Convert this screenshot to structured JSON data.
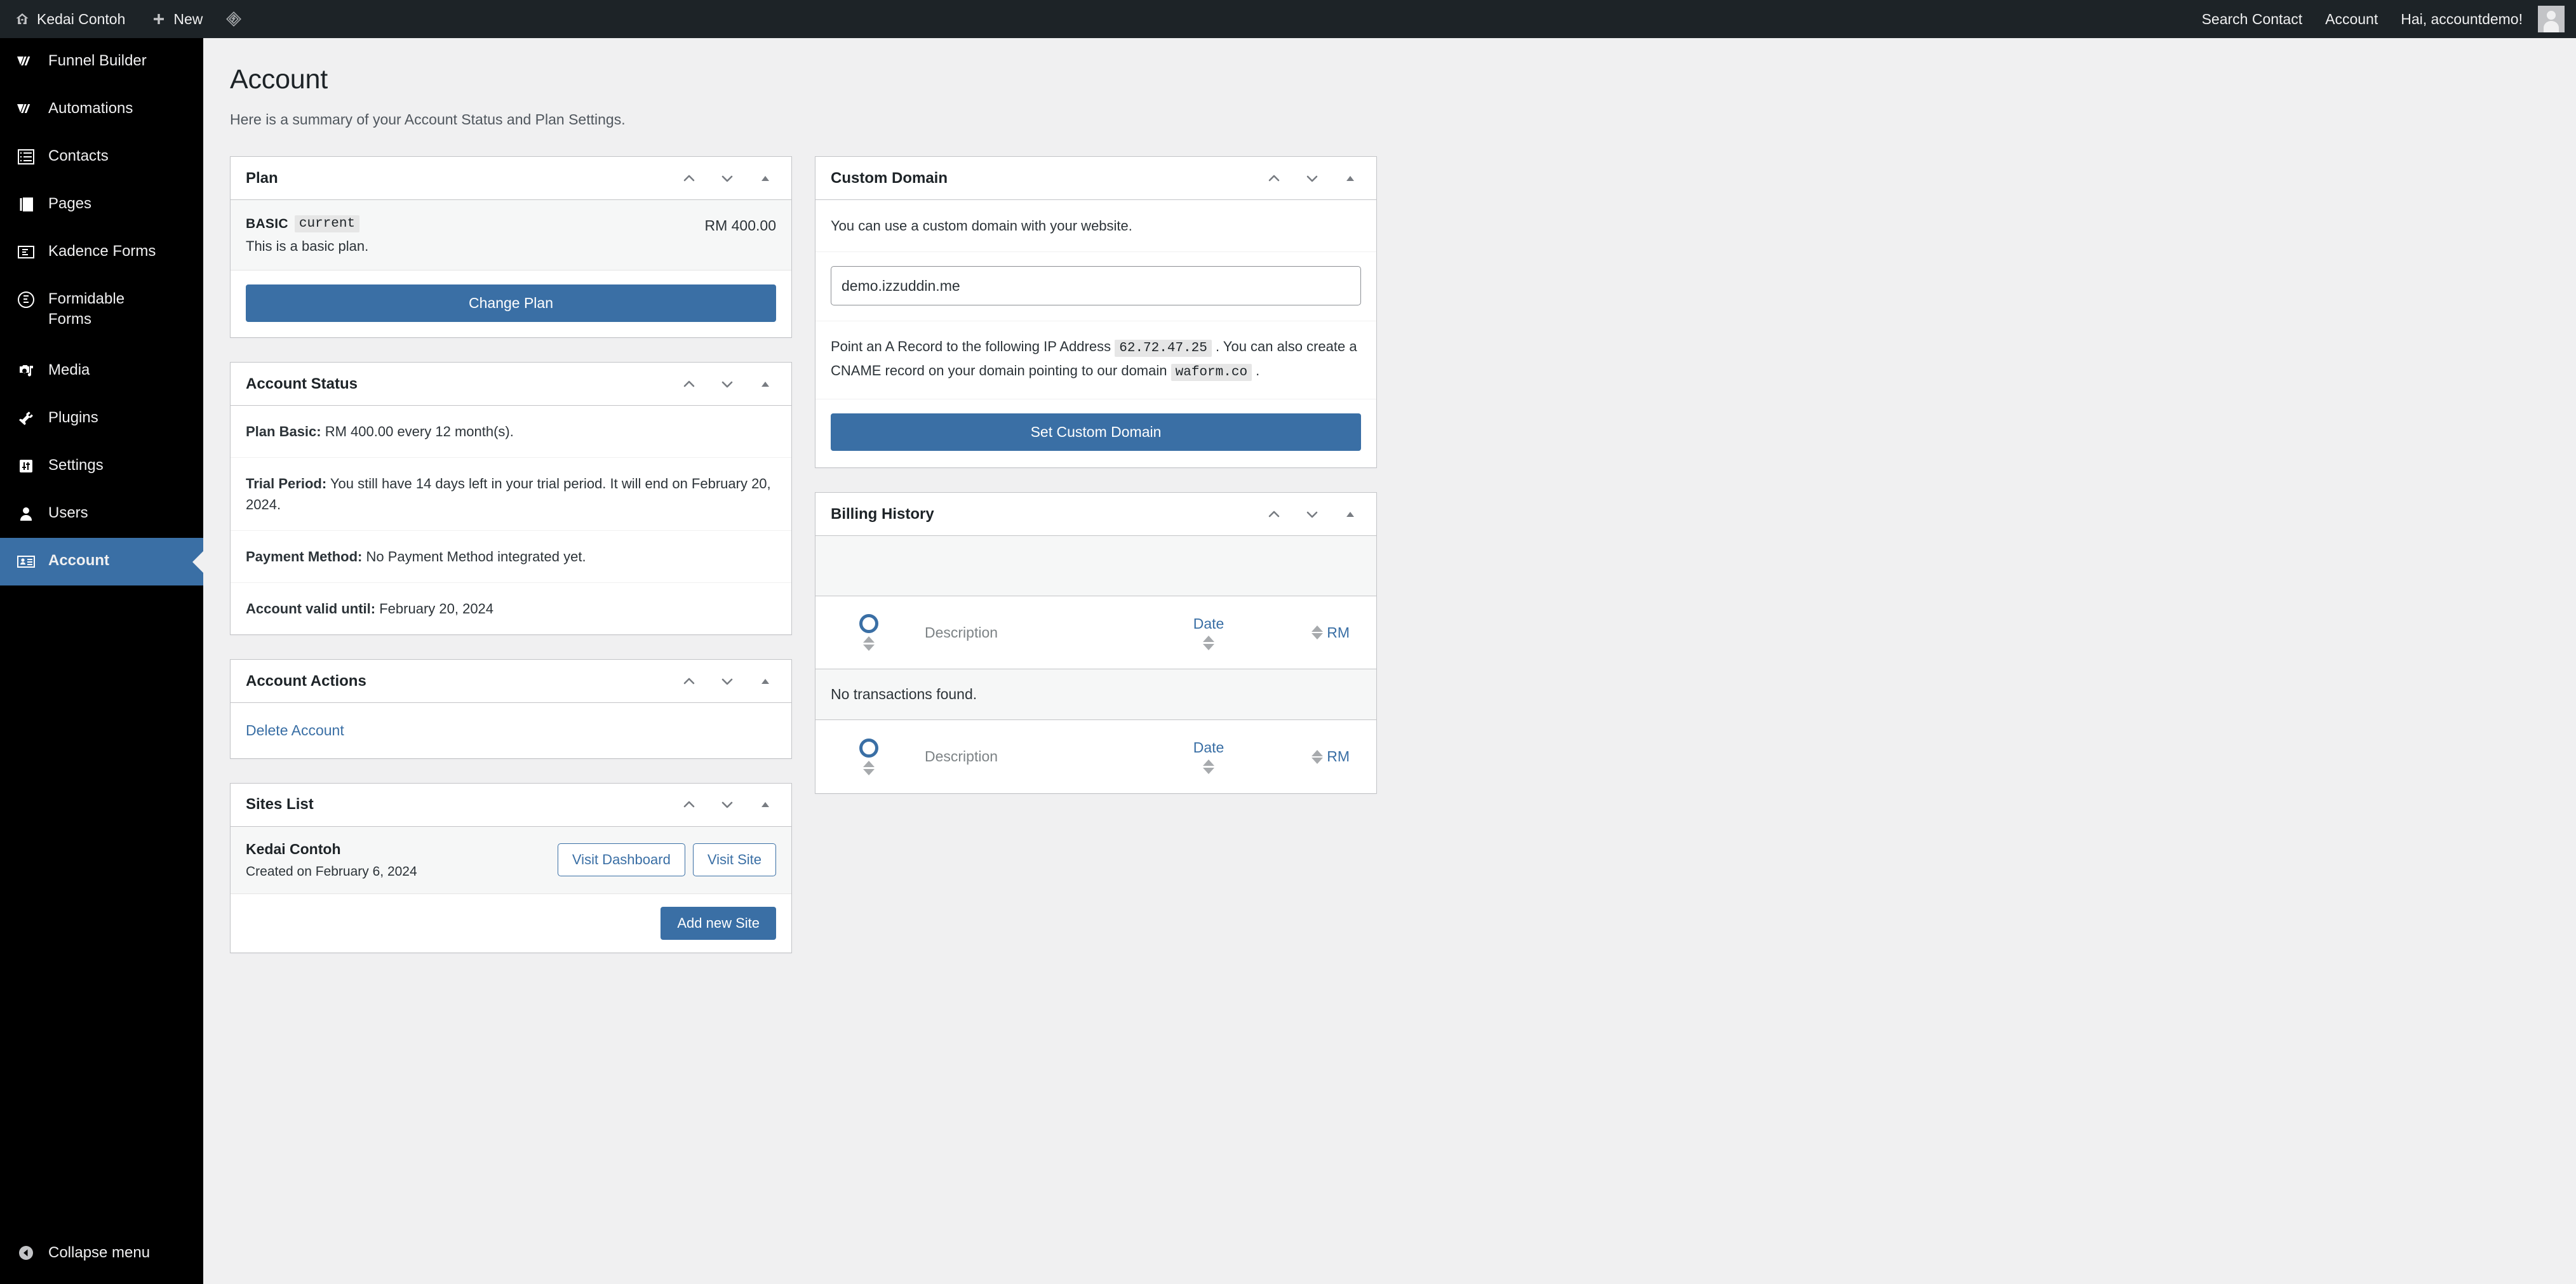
{
  "adminbar": {
    "site_name": "Kedai Contoh",
    "new_label": "New",
    "logo_icon": "diamond-logo-icon",
    "home_icon": "wordpress-home-icon",
    "plus_icon": "plus-icon",
    "right_items": [
      {
        "label": "Search Contact",
        "name": "adminbar-search-contact"
      },
      {
        "label": "Account",
        "name": "adminbar-account"
      },
      {
        "label": "Hai, accountdemo!",
        "name": "adminbar-howdy"
      }
    ],
    "avatar_icon": "user-avatar-icon"
  },
  "sidebar": {
    "items": [
      {
        "label": "Funnel Builder",
        "icon": "funnel-builder-logo-icon",
        "current": false
      },
      {
        "label": "Automations",
        "icon": "automations-logo-icon",
        "current": false
      },
      {
        "label": "Contacts",
        "icon": "list-view-icon",
        "current": false
      },
      {
        "label": "Pages",
        "icon": "pages-icon",
        "current": false
      },
      {
        "label": "Kadence Forms",
        "icon": "kadence-forms-icon",
        "current": false
      },
      {
        "label": "Formidable Forms",
        "icon": "formidable-forms-icon",
        "current": false
      },
      {
        "label": "Media",
        "icon": "media-icon",
        "current": false
      },
      {
        "label": "Plugins",
        "icon": "plugins-plug-icon",
        "current": false
      },
      {
        "label": "Settings",
        "icon": "settings-sliders-icon",
        "current": false
      },
      {
        "label": "Users",
        "icon": "users-person-icon",
        "current": false
      },
      {
        "label": "Account",
        "icon": "id-card-icon",
        "current": true
      }
    ],
    "collapse_label": "Collapse menu",
    "collapse_icon": "collapse-left-arrow-icon",
    "current_bg": "#3a6fa5"
  },
  "page": {
    "title": "Account",
    "subtitle": "Here is a summary of your Account Status and Plan Settings."
  },
  "panels": {
    "plan": {
      "title": "Plan",
      "plan_name": "BASIC",
      "plan_badge": "current",
      "plan_description": "This is a basic plan.",
      "price": "RM 400.00",
      "change_plan_label": "Change Plan"
    },
    "account_status": {
      "title": "Account Status",
      "rows": [
        {
          "label": "Plan Basic:",
          "value": " RM 400.00 every 12 month(s)."
        },
        {
          "label": "Trial Period:",
          "value": " You still have 14 days left in your trial period. It will end on February 20, 2024."
        },
        {
          "label": "Payment Method:",
          "value": " No Payment Method integrated yet."
        },
        {
          "label": "Account valid until:",
          "value": " February 20, 2024"
        }
      ]
    },
    "account_actions": {
      "title": "Account Actions",
      "delete_label": "Delete Account"
    },
    "sites_list": {
      "title": "Sites List",
      "site_name": "Kedai Contoh",
      "site_created": "Created on February 6, 2024",
      "visit_dashboard_label": "Visit Dashboard",
      "visit_site_label": "Visit Site",
      "add_new_site_label": "Add new Site"
    },
    "custom_domain": {
      "title": "Custom Domain",
      "intro": "You can use a custom domain with your website.",
      "domain_value": "demo.izzuddin.me",
      "domain_placeholder": "",
      "note_part1": "Point an A Record to the following IP Address",
      "ip_address": "62.72.47.25",
      "note_part2": ". You can also create a CNAME record on your domain pointing to our domain",
      "cname_domain": "waform.co",
      "note_part3": ".",
      "set_domain_label": "Set Custom Domain"
    },
    "billing_history": {
      "title": "Billing History",
      "col_description": "Description",
      "col_date": "Date",
      "col_amount": "RM",
      "empty_message": "No transactions found.",
      "check_icon": "circle-ring-icon",
      "sort_icon": "sort-arrows-icon"
    }
  },
  "theme": {
    "accent": "#3a6fa5",
    "adminbar_bg": "#1d2327",
    "sidebar_bg": "#000000",
    "content_bg": "#f0f0f1",
    "panel_border": "#c3c4c7"
  }
}
